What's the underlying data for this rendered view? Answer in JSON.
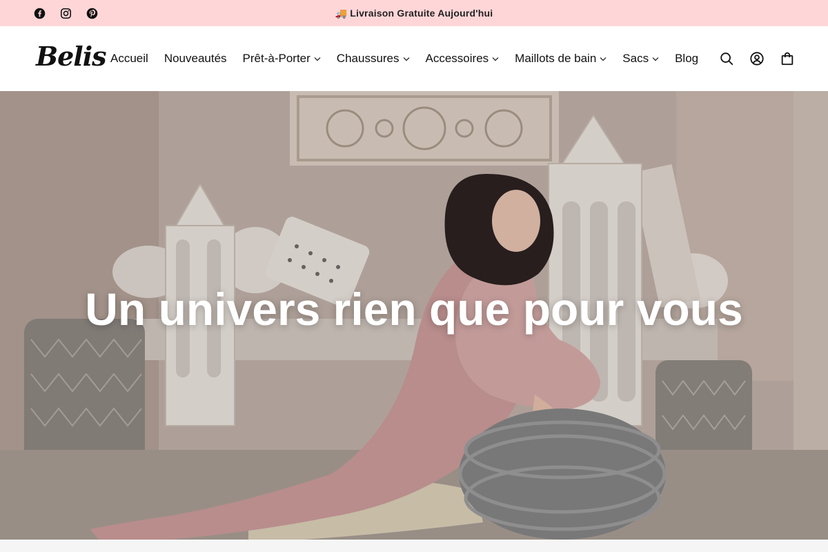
{
  "announcement_bar": {
    "background": "#ffd6d8",
    "icon": "delivery-truck-icon",
    "text": "Livraison Gratuite Aujourd'hui",
    "social": [
      {
        "name": "facebook",
        "icon": "facebook-icon"
      },
      {
        "name": "instagram",
        "icon": "instagram-icon"
      },
      {
        "name": "pinterest",
        "icon": "pinterest-icon"
      }
    ]
  },
  "header": {
    "logo": "Belis",
    "nav": [
      {
        "label": "Accueil",
        "has_dropdown": false
      },
      {
        "label": "Nouveautés",
        "has_dropdown": false
      },
      {
        "label": "Prêt-à-Porter",
        "has_dropdown": true
      },
      {
        "label": "Chaussures",
        "has_dropdown": true
      },
      {
        "label": "Accessoires",
        "has_dropdown": true
      },
      {
        "label": "Maillots de bain",
        "has_dropdown": true
      },
      {
        "label": "Sacs",
        "has_dropdown": true
      },
      {
        "label": "Blog",
        "has_dropdown": false
      }
    ],
    "icons": [
      "search-icon",
      "account-icon",
      "cart-bag-icon"
    ]
  },
  "hero": {
    "title": "Un univers rien que pour vous"
  }
}
